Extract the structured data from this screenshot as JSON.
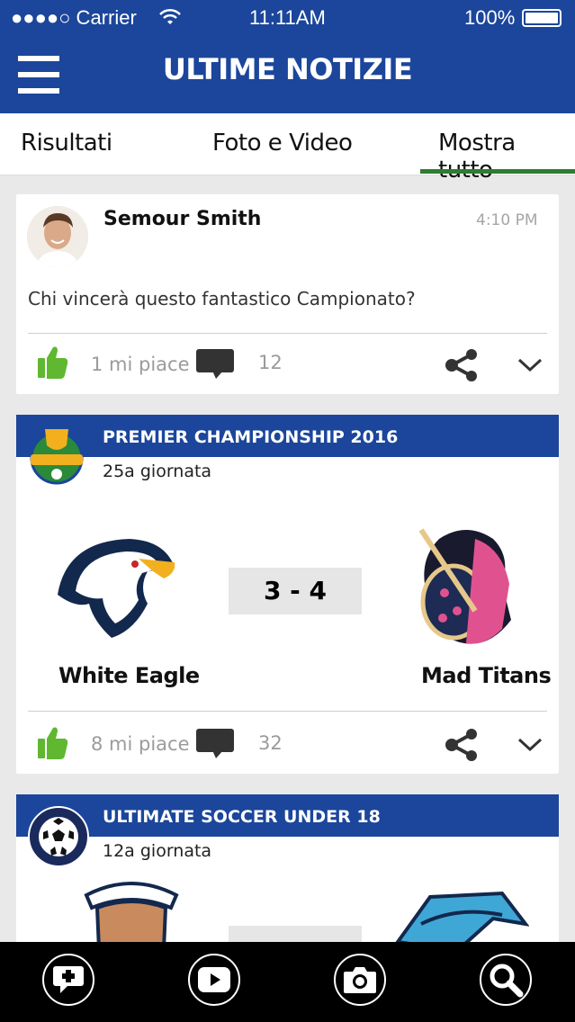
{
  "status_bar": {
    "carrier": "●●●●○ Carrier",
    "time": "11:11AM",
    "battery": "100%"
  },
  "header": {
    "title": "ULTIME NOTIZIE"
  },
  "tabs": [
    {
      "label": "Risultati"
    },
    {
      "label": "Foto e Video"
    },
    {
      "label": "Mostra tutto",
      "active": true
    }
  ],
  "post": {
    "author": "Semour Smith",
    "time": "4:10 PM",
    "text": "Chi vincerà questo fantastico Campionato?",
    "likes": "1 mi piace",
    "comments": "12"
  },
  "matches": [
    {
      "league": "PREMIER CHAMPIONSHIP 2016",
      "round": "25a giornata",
      "home": "White Eagle",
      "away": "Mad Titans",
      "score": "3 - 4",
      "likes": "8 mi piace",
      "comments": "32"
    },
    {
      "league": "ULTIMATE SOCCER UNDER 18",
      "round": "12a giornata"
    }
  ],
  "colors": {
    "brand_blue": "#1b469b",
    "like_green": "#5fb830",
    "active_tab": "#2e7d32"
  },
  "icons": [
    "menu-icon",
    "wifi-icon",
    "battery-icon",
    "thumbs-up-icon",
    "comment-icon",
    "share-icon",
    "chevron-down-icon",
    "add-comment-icon",
    "play-icon",
    "camera-icon",
    "search-icon"
  ]
}
